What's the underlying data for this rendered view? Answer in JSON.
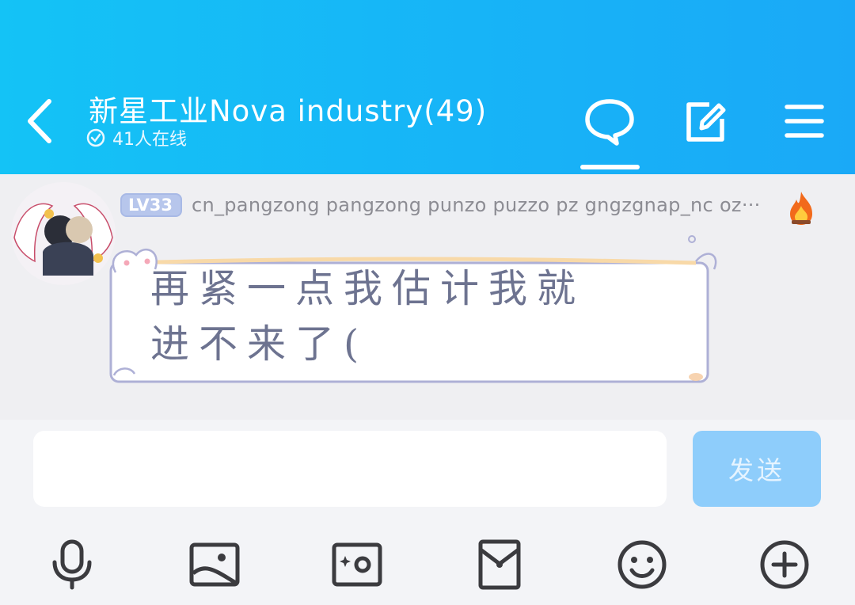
{
  "header": {
    "title": "新星工业Nova industry(49)",
    "online_text": "41人在线",
    "back_icon": "chevron-left-icon",
    "icons": [
      "chat-bubble-icon",
      "edit-icon",
      "menu-icon"
    ],
    "active_tab": "chat"
  },
  "message": {
    "level_badge": "LV33",
    "sender_name": "cn_pangzong pangzong punzo puzzo pz gngzgnap_nc oz···",
    "fire_icon": "fire-icon",
    "text_line1": "再紧一点我估计我就",
    "text_line2": "进不来了("
  },
  "composer": {
    "input_value": "",
    "send_label": "发送"
  },
  "toolbar": {
    "items": [
      "microphone-icon",
      "image-icon",
      "camera-icon",
      "red-packet-icon",
      "emoji-icon",
      "plus-icon"
    ]
  },
  "colors": {
    "header_start": "#14c3f6",
    "header_end": "#1aa9f7",
    "send_button": "#8ecdfb",
    "chat_background": "#efeff2",
    "bubble_text": "#6d7390"
  }
}
